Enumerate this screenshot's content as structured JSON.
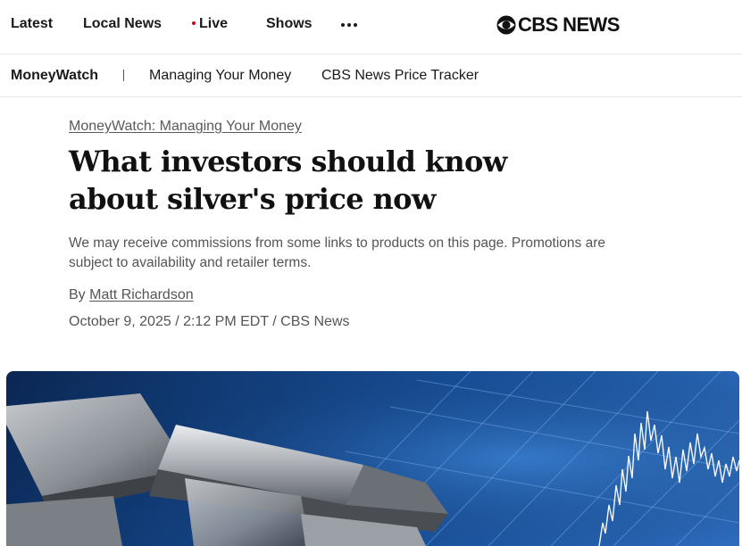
{
  "topnav": {
    "items": [
      {
        "label": "Latest"
      },
      {
        "label": "Local News"
      },
      {
        "label": "Live"
      },
      {
        "label": "Shows"
      }
    ],
    "more_icon": "more-dots-icon",
    "brand": "CBS NEWS",
    "brand_icon": "cbs-eye-icon"
  },
  "subnav": {
    "section": "MoneyWatch",
    "links": [
      {
        "label": "Managing Your Money"
      },
      {
        "label": "CBS News Price Tracker"
      }
    ]
  },
  "article": {
    "breadcrumb": "MoneyWatch: Managing Your Money",
    "headline": "What investors should know about silver's price now",
    "disclaimer": "We may receive commissions from some links to products on this page. Promotions are subject to availability and retailer terms.",
    "byline_prefix": "By",
    "author": "Matt Richardson",
    "dateline": "October 9, 2025 / 2:12 PM EDT / CBS News"
  },
  "colors": {
    "live_dot": "#d0021b",
    "hero_blue": "#17509a"
  }
}
